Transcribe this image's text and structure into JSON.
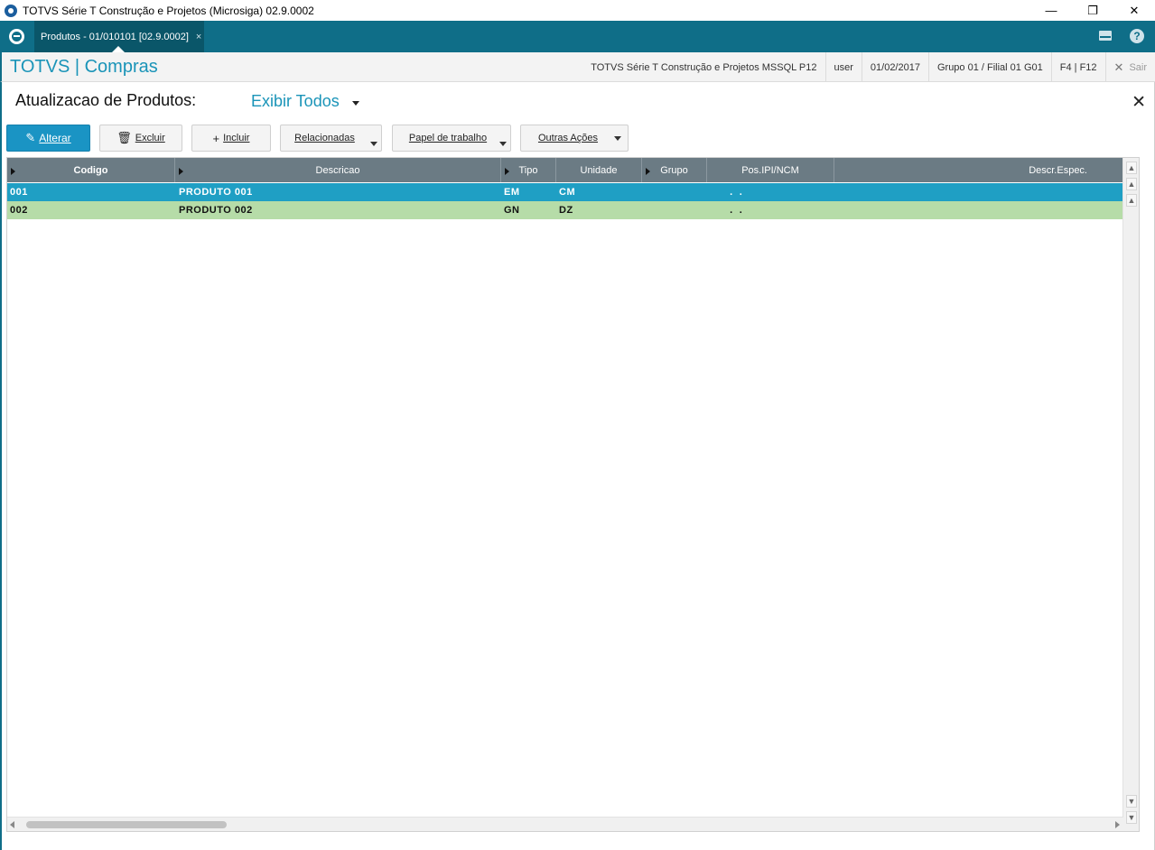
{
  "window": {
    "title": "TOTVS Série T Construção e Projetos (Microsiga) 02.9.0002",
    "minimize": "—",
    "restore": "❐",
    "close": "✕"
  },
  "tabs": [
    {
      "label": "Produtos - 01/010101 [02.9.0002]",
      "close": "×"
    }
  ],
  "header": {
    "app_title": "TOTVS | Compras",
    "environment": "TOTVS Série T Construção e Projetos MSSQL P12",
    "user": "user",
    "date": "01/02/2017",
    "branch": "Grupo 01 / Filial 01 G01",
    "shortcuts": "F4 | F12",
    "exit_label": "Sair",
    "exit_icon": "✕"
  },
  "page": {
    "title": "Atualizacao de Produtos:",
    "filter_label": "Exibir Todos",
    "close": "✕"
  },
  "toolbar": {
    "alterar": "Alterar",
    "excluir": "Excluir",
    "incluir": "Incluir",
    "relacionadas": "Relacionadas",
    "papel": "Papel de trabalho",
    "outras": "Outras Ações"
  },
  "grid": {
    "columns": [
      "Codigo",
      "Descricao",
      "Tipo",
      "Unidade",
      "Grupo",
      "Pos.IPI/NCM",
      "Descr.Espec."
    ],
    "rows": [
      {
        "codigo": "001",
        "descricao": "PRODUTO 001",
        "tipo": "EM",
        "unidade": "CM",
        "grupo": "",
        "ncm": "  .  .",
        "espec": ""
      },
      {
        "codigo": "002",
        "descricao": "PRODUTO 002",
        "tipo": "GN",
        "unidade": "DZ",
        "grupo": "",
        "ncm": "  .  .",
        "espec": ""
      }
    ]
  },
  "colors": {
    "brand": "#0f6e88",
    "accent": "#1a94b8",
    "selected_row": "#1f9fc4",
    "alt_row": "#b6dca8",
    "grid_header": "#6b7b84"
  }
}
